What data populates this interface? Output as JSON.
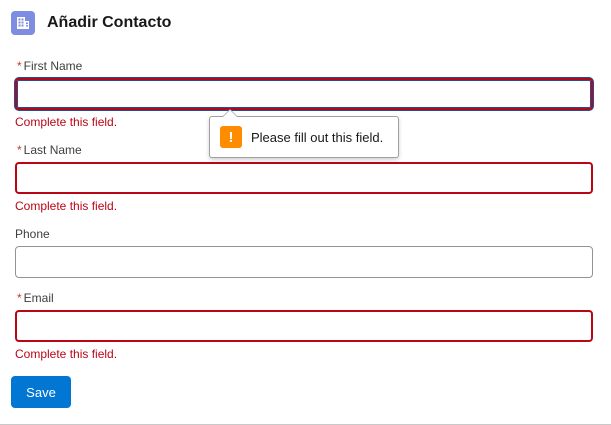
{
  "header": {
    "title": "Añadir Contacto",
    "icon": "contact-building-icon",
    "icon_color": "#7f8de1"
  },
  "form": {
    "first_name": {
      "required_mark": "*",
      "label": "First Name",
      "value": "",
      "error": "Complete this field."
    },
    "last_name": {
      "required_mark": "*",
      "label": "Last Name",
      "value": "",
      "error": "Complete this field."
    },
    "phone": {
      "label": "Phone",
      "value": ""
    },
    "email": {
      "required_mark": "*",
      "label": "Email",
      "value": "",
      "error": "Complete this field."
    }
  },
  "tooltip": {
    "icon": "warning-icon",
    "icon_glyph": "!",
    "text": "Please fill out this field."
  },
  "actions": {
    "save_label": "Save",
    "save_color": "#0176d3"
  },
  "colors": {
    "error": "#ba0517",
    "focus": "#1b5297"
  }
}
